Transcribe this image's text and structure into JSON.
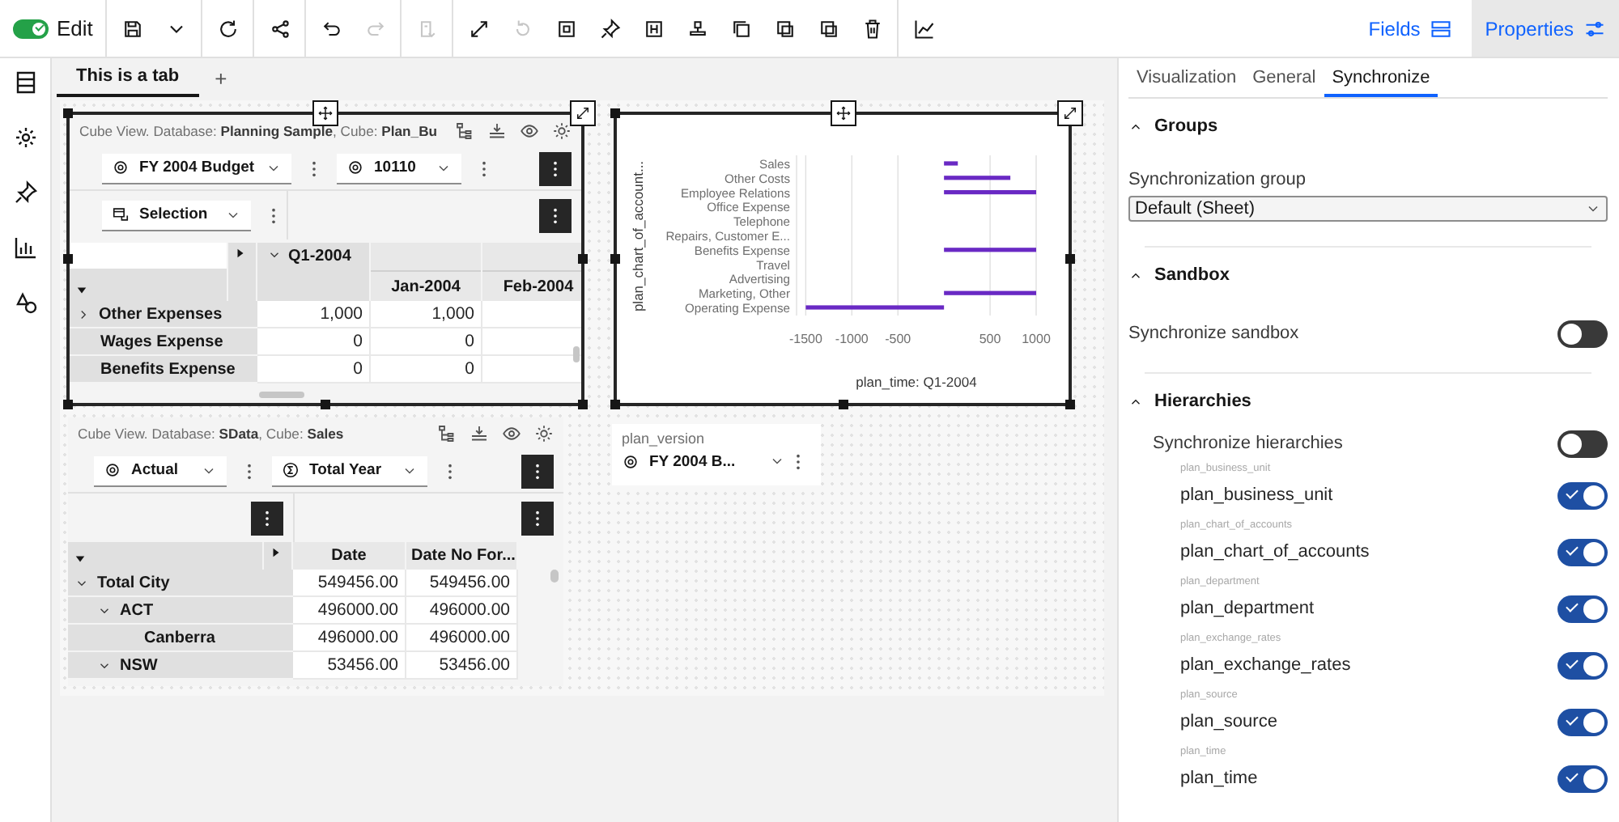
{
  "toolbar": {
    "edit": {
      "label": "Edit",
      "on": true
    },
    "button_groups": [
      [
        {
          "kind": "save",
          "disabled": false
        },
        {
          "kind": "caret",
          "disabled": false
        }
      ],
      [
        {
          "kind": "refresh",
          "disabled": false
        }
      ],
      [
        {
          "kind": "share",
          "disabled": false
        }
      ],
      [
        {
          "kind": "undo",
          "disabled": false
        },
        {
          "kind": "redo",
          "disabled": true
        }
      ],
      [
        {
          "kind": "paste",
          "disabled": true
        }
      ],
      [
        {
          "kind": "expand",
          "disabled": false
        },
        {
          "kind": "reset",
          "disabled": true
        },
        {
          "kind": "fit",
          "disabled": false
        },
        {
          "kind": "pin",
          "disabled": false
        },
        {
          "kind": "frame",
          "disabled": false
        },
        {
          "kind": "stamp",
          "disabled": false
        },
        {
          "kind": "copy",
          "disabled": false
        },
        {
          "kind": "front",
          "disabled": false
        },
        {
          "kind": "back",
          "disabled": false
        },
        {
          "kind": "delete",
          "disabled": false
        }
      ],
      [
        {
          "kind": "chart",
          "disabled": false
        }
      ]
    ],
    "fields": {
      "label": "Fields",
      "selected": false
    },
    "properties": {
      "label": "Properties",
      "selected": true
    }
  },
  "rail": [
    {
      "kind": "list"
    },
    {
      "kind": "sun"
    },
    {
      "kind": "pin"
    },
    {
      "kind": "bars"
    },
    {
      "kind": "shapes"
    }
  ],
  "tabs": [
    {
      "label": "This is a tab",
      "selected": true
    }
  ],
  "add_tab": "+",
  "widgets": [
    {
      "kind": "cube_view",
      "selected": true,
      "header": "Cube View. Database: **Planning Sample**, Cube: **Plan_Bu**",
      "selectors": [
        {
          "kind": "member",
          "label": "FY 2004 Budget"
        },
        {
          "kind": "member",
          "label": "10110"
        }
      ],
      "row2_selectors": [
        {
          "kind": "subset",
          "label": "Selection"
        }
      ],
      "columns": [
        {
          "label": "Q1-2004",
          "expanded": true
        },
        {
          "label": "Jan-2004"
        },
        {
          "label": "Feb-2004"
        }
      ],
      "rows": [
        {
          "label": "Other Expenses",
          "expanded": false,
          "cells": [
            "1,000",
            "1,000"
          ]
        },
        {
          "label": "Wages Expense",
          "cells": [
            "0",
            "0"
          ]
        },
        {
          "label": "Benefits Expense",
          "cells": [
            "0",
            "0"
          ]
        }
      ]
    },
    {
      "kind": "chart",
      "selected": true,
      "chart_data": {
        "type": "bar",
        "orientation": "horizontal",
        "xlabel": "plan_time: Q1-2004",
        "ylabel": "plan_chart_of_account...",
        "categories": [
          "Sales",
          "Other Costs",
          "Employee Relations",
          "Office Expense",
          "Telephone",
          "Repairs, Customer E...",
          "Benefits Expense",
          "Travel",
          "Advertising",
          "Marketing, Other",
          "Operating Expense"
        ],
        "series": [
          {
            "color": "#6929c4",
            "values": [
              150,
              720,
              1000,
              null,
              null,
              null,
              1000,
              null,
              null,
              1000,
              -1500
            ]
          }
        ],
        "xlim": [
          -1600,
          1000
        ],
        "grid": true,
        "xticks": [
          -1500,
          -1000,
          -500,
          500,
          1000
        ]
      }
    },
    {
      "kind": "cube_view",
      "selected": false,
      "header": "Cube View. Database: **SData**, Cube: **Sales**",
      "selectors": [
        {
          "kind": "member",
          "label": "Actual"
        },
        {
          "kind": "consolidation",
          "label": "Total Year"
        }
      ],
      "columns": [
        {
          "label": "Date"
        },
        {
          "label": "Date No For..."
        }
      ],
      "rows": [
        {
          "label": "Total City",
          "expanded": true,
          "cells": [
            "549456.00",
            "549456.00"
          ],
          "children": [
            {
              "label": "ACT",
              "expanded": true,
              "cells": [
                "496000.00",
                "496000.00"
              ],
              "children": [
                {
                  "label": "Canberra",
                  "cells": [
                    "496000.00",
                    "496000.00"
                  ]
                }
              ]
            },
            {
              "label": "NSW",
              "expanded": true,
              "cells": [
                "53456.00",
                "53456.00"
              ]
            }
          ]
        }
      ]
    },
    {
      "kind": "selector",
      "selected": false,
      "label": "plan_version",
      "value": "FY 2004 B..."
    }
  ],
  "properties_panel": {
    "tabs": [
      {
        "label": "Visualization",
        "selected": false
      },
      {
        "label": "General",
        "selected": false
      },
      {
        "label": "Synchronize",
        "selected": true
      }
    ],
    "sections": [
      {
        "kind": "groups",
        "title": "Groups",
        "expanded": true,
        "field_label": "Synchronization group",
        "value": "Default (Sheet)"
      },
      {
        "kind": "sandbox",
        "title": "Sandbox",
        "expanded": true,
        "label": "Synchronize sandbox",
        "on": false
      },
      {
        "kind": "hierarchies",
        "title": "Hierarchies",
        "expanded": true,
        "label": "Synchronize hierarchies",
        "on": false,
        "items": [
          {
            "caption": "plan_business_unit",
            "label": "plan_business_unit",
            "on": true
          },
          {
            "caption": "plan_chart_of_accounts",
            "label": "plan_chart_of_accounts",
            "on": true
          },
          {
            "caption": "plan_department",
            "label": "plan_department",
            "on": true
          },
          {
            "caption": "plan_exchange_rates",
            "label": "plan_exchange_rates",
            "on": true
          },
          {
            "caption": "plan_source",
            "label": "plan_source",
            "on": true
          },
          {
            "caption": "plan_time",
            "label": "plan_time",
            "on": true
          }
        ]
      }
    ]
  }
}
